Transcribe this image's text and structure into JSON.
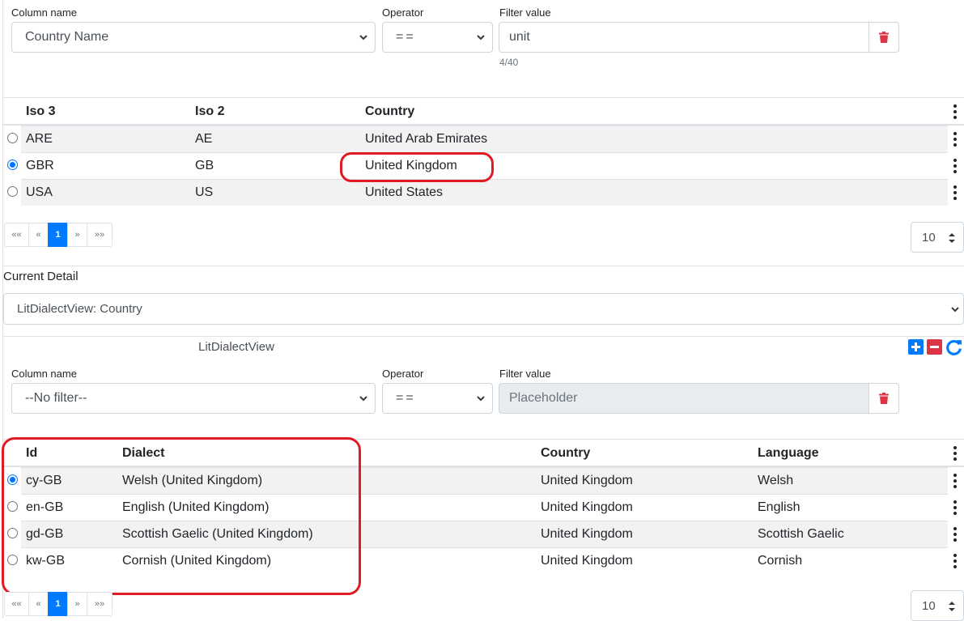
{
  "filter1": {
    "column_label": "Column name",
    "column_value": "Country Name",
    "operator_label": "Operator",
    "operator_value": "==",
    "value_label": "Filter value",
    "value_value": "unit",
    "char_count": "4/40"
  },
  "grid1": {
    "headers": [
      "Iso 3",
      "Iso 2",
      "Country"
    ],
    "rows": [
      {
        "iso3": "ARE",
        "iso2": "AE",
        "country": "United Arab Emirates",
        "selected": false
      },
      {
        "iso3": "GBR",
        "iso2": "GB",
        "country": "United Kingdom",
        "selected": true
      },
      {
        "iso3": "USA",
        "iso2": "US",
        "country": "United States",
        "selected": false
      }
    ],
    "pager": {
      "first": "««",
      "prev": "«",
      "page": "1",
      "next": "»",
      "last": "»»"
    },
    "page_size": "10"
  },
  "detail": {
    "label": "Current Detail",
    "select_value": "LitDialectView: Country",
    "view_title": "LitDialectView"
  },
  "filter2": {
    "column_label": "Column name",
    "column_value": "--No filter--",
    "operator_label": "Operator",
    "operator_value": "==",
    "value_label": "Filter value",
    "value_placeholder": "Placeholder"
  },
  "grid2": {
    "headers": [
      "Id",
      "Dialect",
      "Country",
      "Language"
    ],
    "rows": [
      {
        "id": "cy-GB",
        "dialect": "Welsh (United Kingdom)",
        "country": "United Kingdom",
        "language": "Welsh",
        "selected": true
      },
      {
        "id": "en-GB",
        "dialect": "English (United Kingdom)",
        "country": "United Kingdom",
        "language": "English",
        "selected": false
      },
      {
        "id": "gd-GB",
        "dialect": "Scottish Gaelic (United Kingdom)",
        "country": "United Kingdom",
        "language": "Scottish Gaelic",
        "selected": false
      },
      {
        "id": "kw-GB",
        "dialect": "Cornish (United Kingdom)",
        "country": "United Kingdom",
        "language": "Cornish",
        "selected": false
      }
    ],
    "pager": {
      "first": "««",
      "prev": "«",
      "page": "1",
      "next": "»",
      "last": "»»"
    },
    "page_size": "10"
  },
  "icons": {
    "trash": "trash-icon",
    "add": "plus-square-icon",
    "remove": "minus-square-icon",
    "refresh": "refresh-icon",
    "kebab": "vertical-ellipsis-icon"
  },
  "colors": {
    "primary": "#007bff",
    "danger": "#dc3545",
    "annotation": "#e01b24",
    "stripe": "#f2f2f2"
  }
}
